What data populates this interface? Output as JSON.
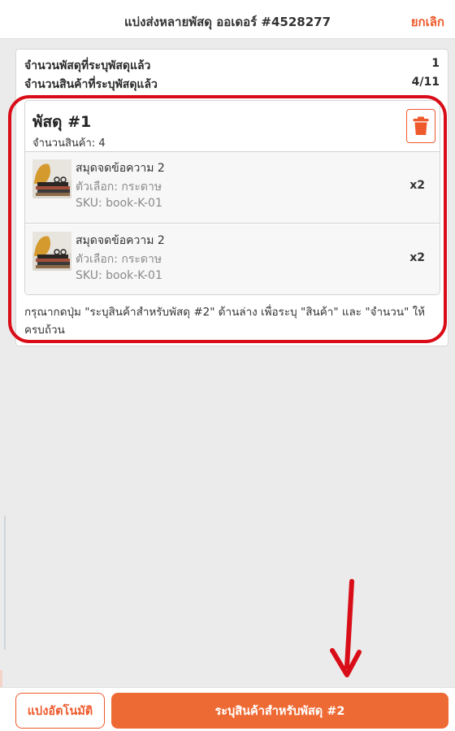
{
  "header": {
    "title": "แบ่งส่งหลายพัสดุ ออเดอร์ #4528277",
    "cancel_label": "ยกเลิก"
  },
  "summary": {
    "parcels_label": "จำนวนพัสดุที่ระบุพัสดุแล้ว",
    "parcels_value": "1",
    "items_label": "จำนวนสินค้าที่ระบุพัสดุแล้ว",
    "items_value": "4/11"
  },
  "parcel": {
    "title": "พัสดุ #1",
    "count_text": "จำนวนสินค้า: 4",
    "delete_icon": "trash-icon",
    "items": [
      {
        "name": "สมุดจดข้อความ 2",
        "option": "ตัวเลือก: กระดาษ",
        "sku": "SKU: book-K-01",
        "qty": "x2"
      },
      {
        "name": "สมุดจดข้อความ 2",
        "option": "ตัวเลือก: กระดาษ",
        "sku": "SKU: book-K-01",
        "qty": "x2"
      }
    ]
  },
  "hint": "กรุณากดปุ่ม \"ระบุสินค้าสำหรับพัสดุ #2\" ด้านล่าง เพื่อระบุ \"สินค้า\" และ \"จำนวน\" ให้ครบถ้วน",
  "footer": {
    "auto_split_label": "แบ่งอัตโนมัติ",
    "next_label": "ระบุสินค้าสำหรับพัสดุ #2"
  },
  "colors": {
    "accent": "#ee5a2c",
    "button": "#ee6a34",
    "annotation": "#d90d17"
  }
}
